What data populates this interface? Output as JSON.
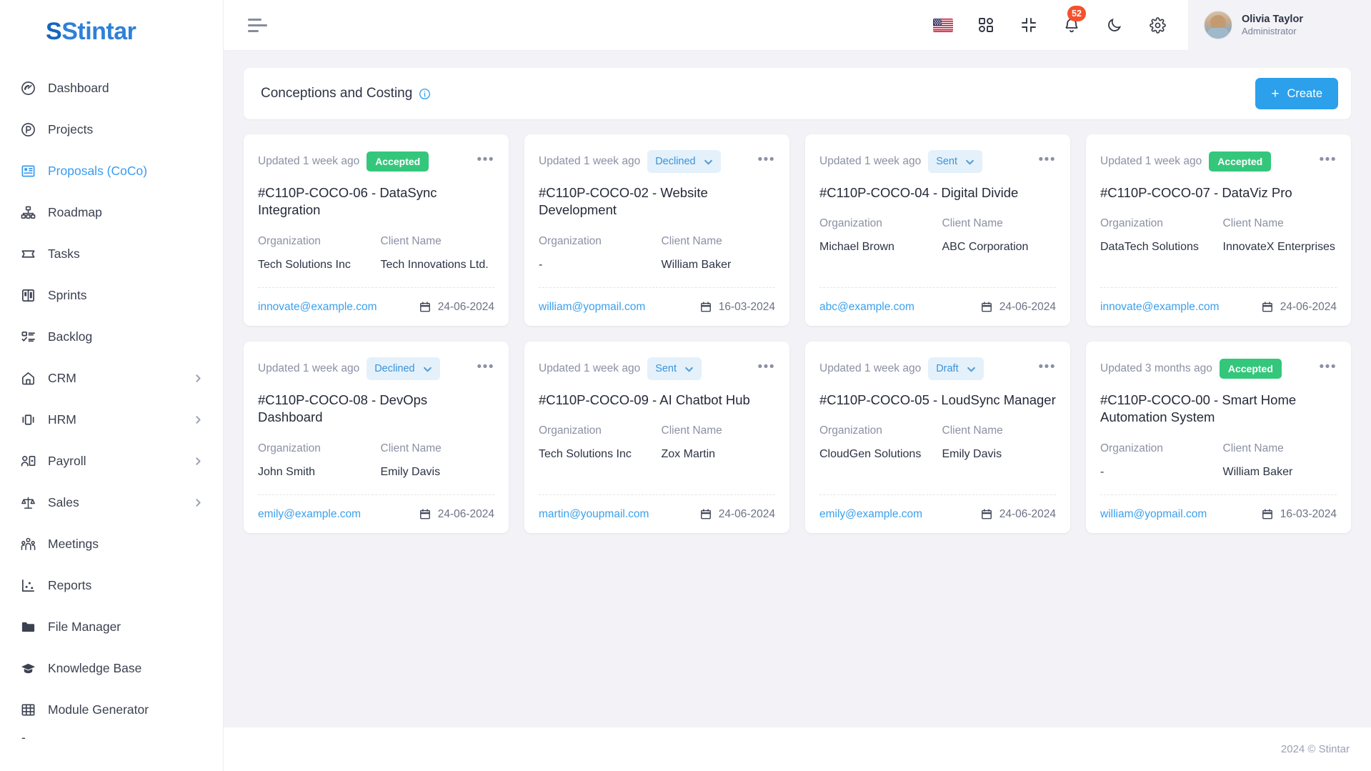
{
  "brand": {
    "name": "Stintar"
  },
  "sidebar": {
    "items": [
      {
        "label": "Dashboard",
        "icon": "gauge-icon",
        "active": false,
        "expandable": false
      },
      {
        "label": "Projects",
        "icon": "project-circle-icon",
        "active": false,
        "expandable": false
      },
      {
        "label": "Proposals (CoCo)",
        "icon": "proposals-icon",
        "active": true,
        "expandable": false
      },
      {
        "label": "Roadmap",
        "icon": "roadmap-icon",
        "active": false,
        "expandable": false
      },
      {
        "label": "Tasks",
        "icon": "tasks-icon",
        "active": false,
        "expandable": false
      },
      {
        "label": "Sprints",
        "icon": "sprints-icon",
        "active": false,
        "expandable": false
      },
      {
        "label": "Backlog",
        "icon": "backlog-icon",
        "active": false,
        "expandable": false
      },
      {
        "label": "CRM",
        "icon": "crm-icon",
        "active": false,
        "expandable": true
      },
      {
        "label": "HRM",
        "icon": "hrm-icon",
        "active": false,
        "expandable": true
      },
      {
        "label": "Payroll",
        "icon": "payroll-icon",
        "active": false,
        "expandable": true
      },
      {
        "label": "Sales",
        "icon": "sales-scale-icon",
        "active": false,
        "expandable": true
      },
      {
        "label": "Meetings",
        "icon": "meetings-icon",
        "active": false,
        "expandable": false
      },
      {
        "label": "Reports",
        "icon": "reports-icon",
        "active": false,
        "expandable": false
      },
      {
        "label": "File Manager",
        "icon": "folder-icon",
        "active": false,
        "expandable": false
      },
      {
        "label": "Knowledge Base",
        "icon": "graduation-cap-icon",
        "active": false,
        "expandable": false
      },
      {
        "label": "Module Generator",
        "icon": "grid-table-icon",
        "active": false,
        "expandable": false
      }
    ],
    "truncated_item": "-"
  },
  "topbar": {
    "menu_toggle": "hamburger-icon",
    "language_flag": "us-flag-icon",
    "apps_icon": "apps-grid-icon",
    "fullscreen_icon": "collapse-screen-icon",
    "notifications_icon": "bell-icon",
    "notifications_count": "52",
    "theme_icon": "moon-icon",
    "settings_icon": "gear-icon",
    "user": {
      "name": "Olivia Taylor",
      "role": "Administrator"
    }
  },
  "page": {
    "title": "Conceptions and Costing",
    "info_icon": "info-circle-icon",
    "create_label": "Create",
    "create_plus": "+"
  },
  "labels": {
    "organization": "Organization",
    "client_name": "Client Name",
    "menu_dots": "•••"
  },
  "cards": [
    {
      "updated": "Updated 1 week ago",
      "status": "Accepted",
      "status_type": "static",
      "title": "#C110P-COCO-06 - DataSync Integration",
      "organization": "Tech Solutions Inc",
      "client": "Tech Innovations Ltd.",
      "email": "innovate@example.com",
      "date": "24-06-2024"
    },
    {
      "updated": "Updated 1 week ago",
      "status": "Declined",
      "status_type": "select",
      "title": "#C110P-COCO-02 - Website Development",
      "organization": "-",
      "client": "William Baker",
      "email": "william@yopmail.com",
      "date": "16-03-2024"
    },
    {
      "updated": "Updated 1 week ago",
      "status": "Sent",
      "status_type": "select",
      "title": "#C110P-COCO-04 - Digital Divide",
      "organization": "Michael Brown",
      "client": "ABC Corporation",
      "email": "abc@example.com",
      "date": "24-06-2024"
    },
    {
      "updated": "Updated 1 week ago",
      "status": "Accepted",
      "status_type": "static",
      "title": "#C110P-COCO-07 - DataViz Pro",
      "organization": "DataTech Solutions",
      "client": "InnovateX Enterprises",
      "email": "innovate@example.com",
      "date": "24-06-2024"
    },
    {
      "updated": "Updated 1 week ago",
      "status": "Declined",
      "status_type": "select",
      "title": "#C110P-COCO-08 - DevOps Dashboard",
      "organization": "John Smith",
      "client": "Emily Davis",
      "email": "emily@example.com",
      "date": "24-06-2024"
    },
    {
      "updated": "Updated 1 week ago",
      "status": "Sent",
      "status_type": "select",
      "title": "#C110P-COCO-09 - AI Chatbot Hub",
      "organization": "Tech Solutions Inc",
      "client": "Zox Martin",
      "email": "martin@youpmail.com",
      "date": "24-06-2024"
    },
    {
      "updated": "Updated 1 week ago",
      "status": "Draft",
      "status_type": "select",
      "title": "#C110P-COCO-05 - LoudSync Manager",
      "organization": "CloudGen Solutions",
      "client": "Emily Davis",
      "email": "emily@example.com",
      "date": "24-06-2024"
    },
    {
      "updated": "Updated 3 months ago",
      "status": "Accepted",
      "status_type": "static",
      "title": "#C110P-COCO-00 - Smart Home Automation System",
      "organization": "-",
      "client": "William Baker",
      "email": "william@yopmail.com",
      "date": "16-03-2024"
    }
  ],
  "footer": {
    "copyright": "2024 © Stintar"
  },
  "colors": {
    "accent": "#2ca0eb",
    "accent_link": "#3ba0ec",
    "status_accepted_bg": "#34c77b",
    "status_select_bg": "#e4f1fb",
    "status_select_text": "#3a93d8",
    "badge_bg": "#f4512c",
    "page_bg": "#f2f2f7",
    "sidebar_active": "#3a9bf0"
  }
}
